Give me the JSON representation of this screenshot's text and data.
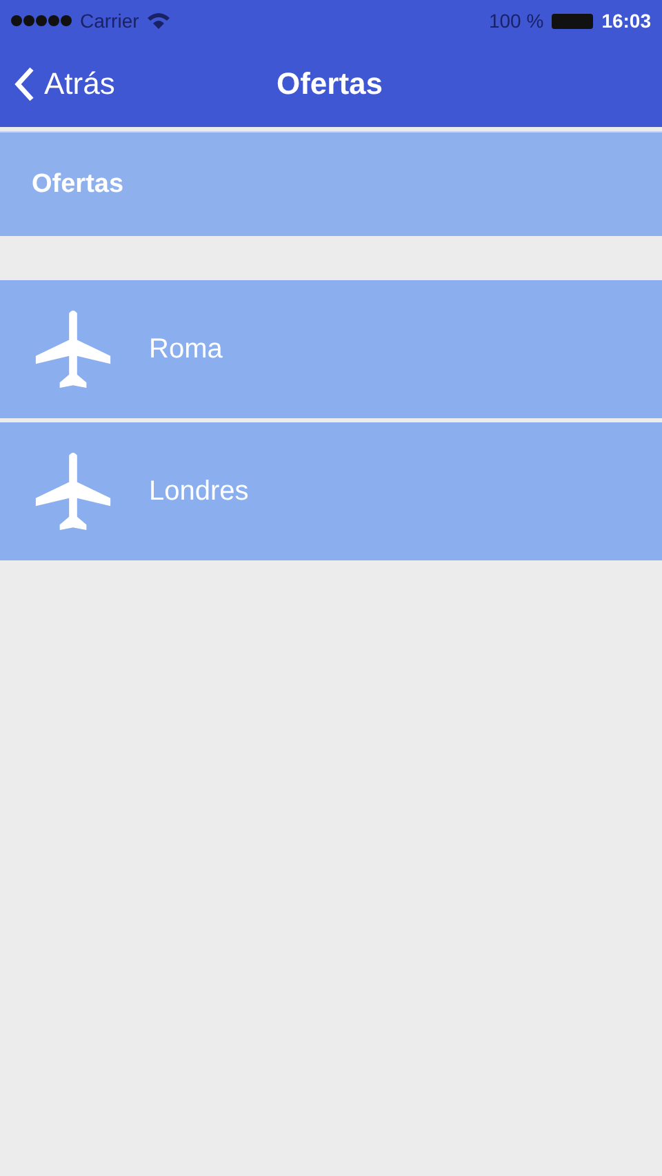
{
  "status_bar": {
    "carrier": "Carrier",
    "battery": "100 %",
    "time": "16:03"
  },
  "nav_bar": {
    "back": "Atrás",
    "title": "Ofertas"
  },
  "section_header": "Ofertas",
  "items": [
    {
      "label": "Roma"
    },
    {
      "label": "Londres"
    }
  ]
}
